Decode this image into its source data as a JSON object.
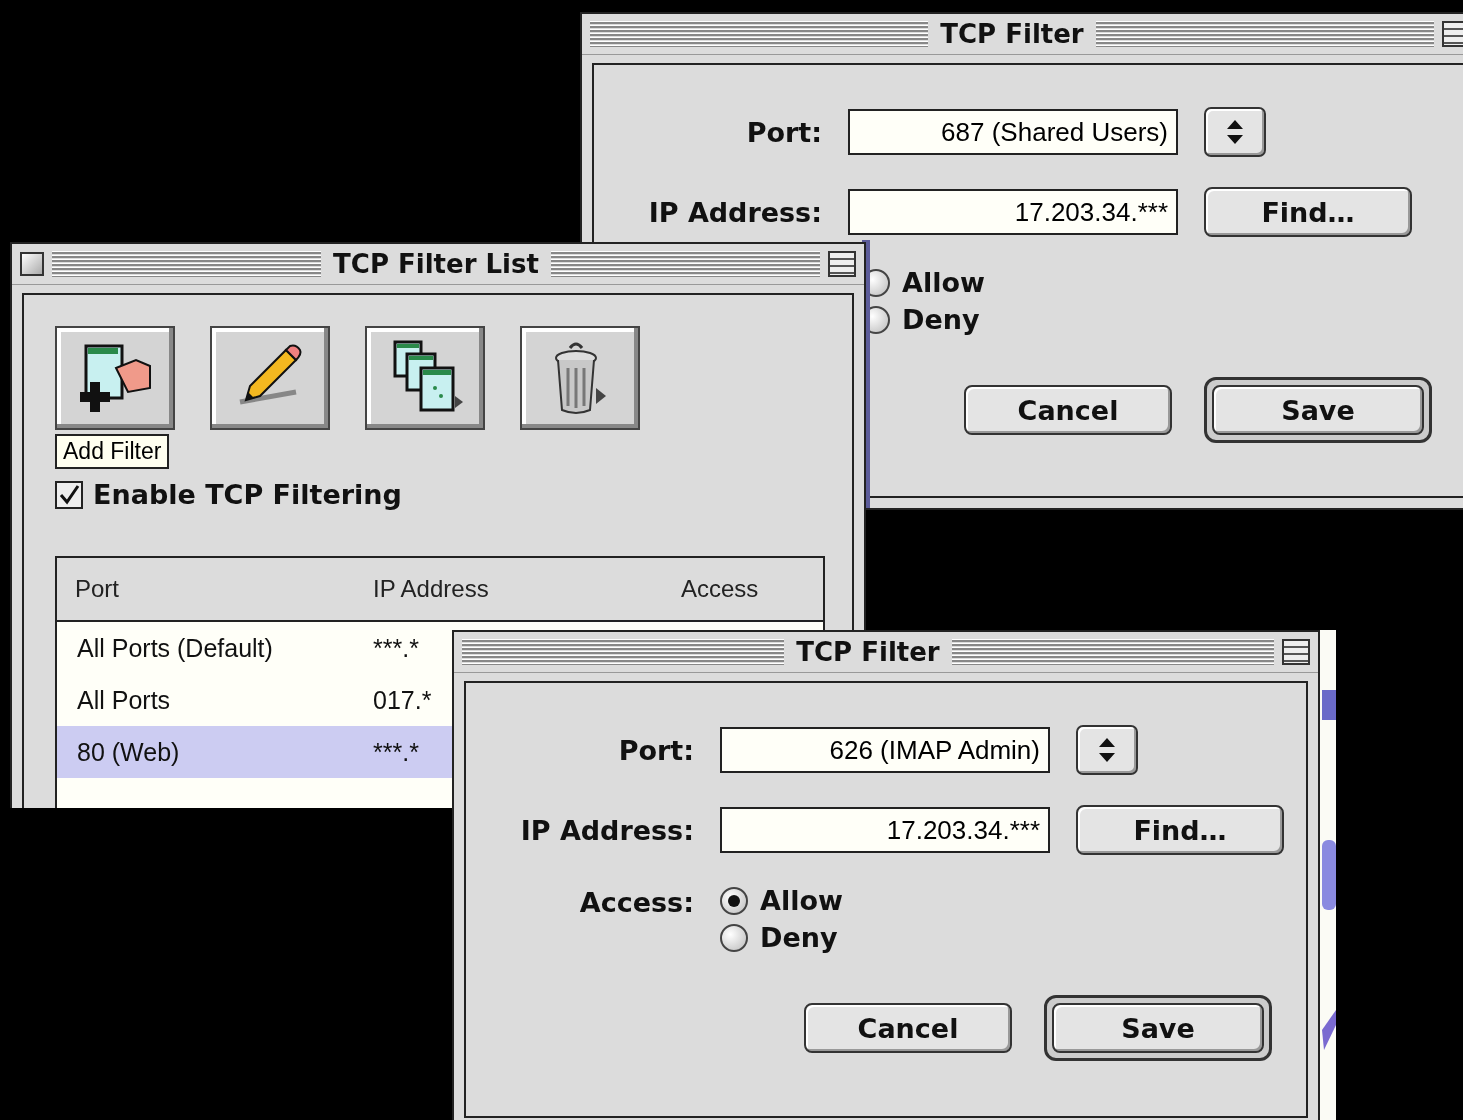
{
  "windows": [
    {
      "kind": "filter_dialog",
      "title": "TCP Filter",
      "port_label": "Port:",
      "port": "687 (Shared Users)",
      "ip_label": "IP Address:",
      "ip": "17.203.34.***",
      "find_button": "Find…",
      "access_options": [
        {
          "label": "Allow",
          "selected": false
        },
        {
          "label": "Deny",
          "selected": false
        }
      ],
      "buttons": [
        {
          "label": "Cancel",
          "default": false
        },
        {
          "label": "Save",
          "default": true
        }
      ]
    },
    {
      "kind": "filter_list",
      "title": "TCP Filter List",
      "tooltip": "Add Filter",
      "enable_checkbox": {
        "label": "Enable TCP Filtering",
        "checked": true
      },
      "columns": [
        "Port",
        "IP Address",
        "Access"
      ],
      "rows": [
        {
          "port": "All Ports (Default)",
          "ip": "***.*",
          "selected": false
        },
        {
          "port": "All Ports",
          "ip": "017.*",
          "selected": false
        },
        {
          "port": "80 (Web)",
          "ip": "***.*",
          "selected": true
        }
      ]
    },
    {
      "kind": "filter_dialog",
      "title": "TCP Filter",
      "port_label": "Port:",
      "port": "626 (IMAP Admin)",
      "ip_label": "IP Address:",
      "ip": "17.203.34.***",
      "find_button": "Find…",
      "access_label": "Access:",
      "access_options": [
        {
          "label": "Allow",
          "selected": true
        },
        {
          "label": "Deny",
          "selected": false
        }
      ],
      "buttons": [
        {
          "label": "Cancel",
          "default": false
        },
        {
          "label": "Save",
          "default": true
        }
      ]
    }
  ]
}
